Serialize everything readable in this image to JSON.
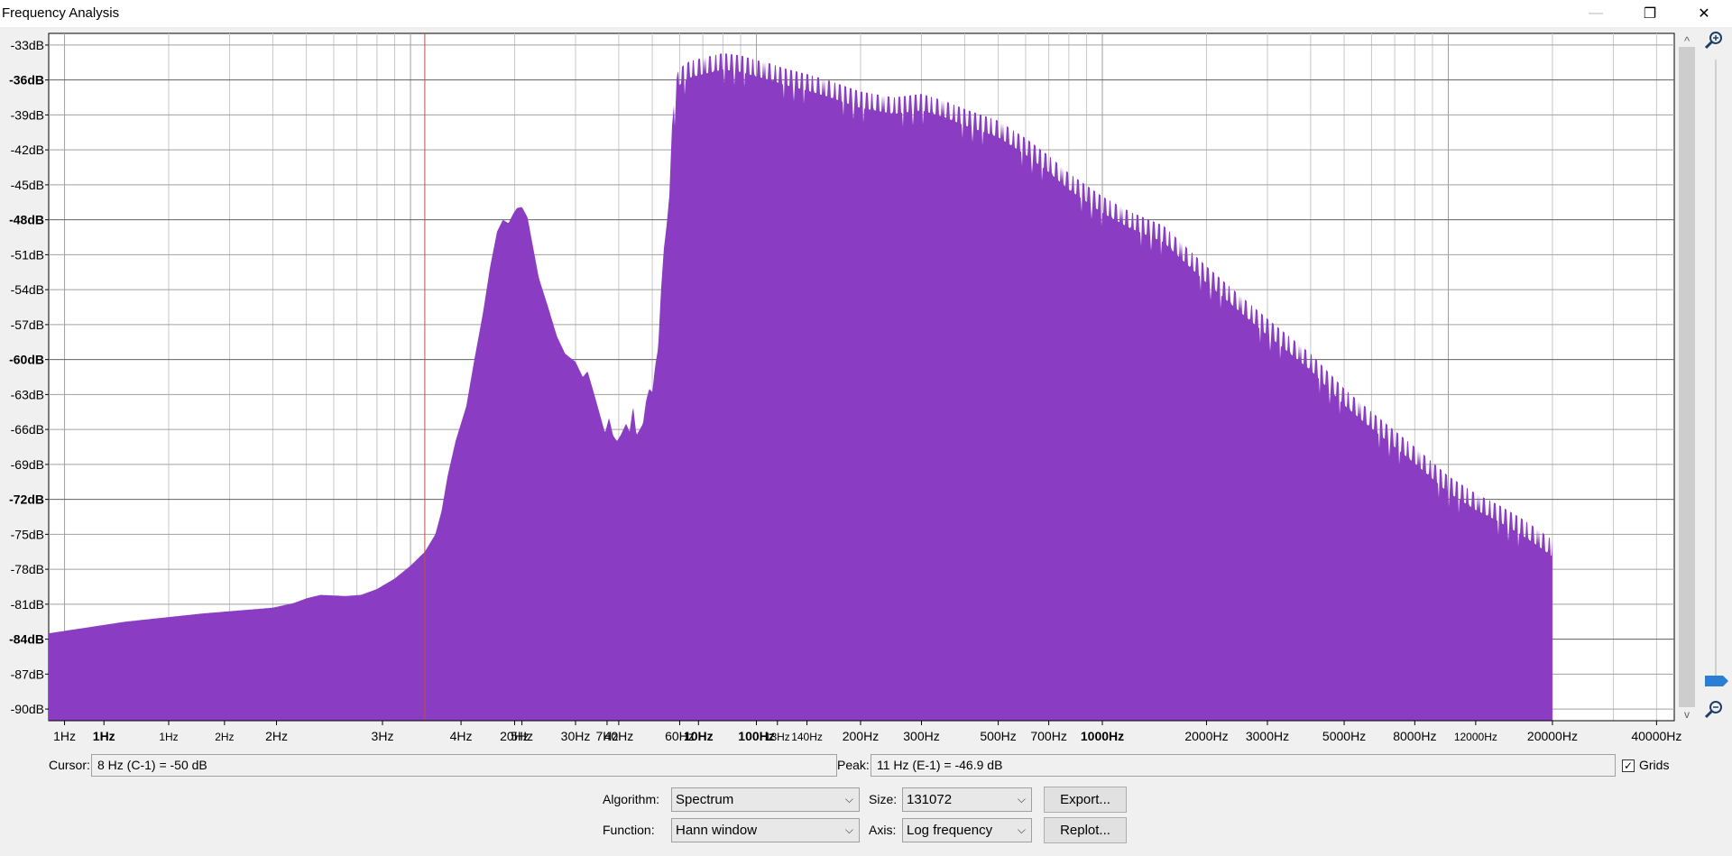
{
  "window": {
    "title": "Frequency Analysis",
    "controls": {
      "minimize": "—",
      "restore": "❐",
      "close": "✕"
    }
  },
  "colors": {
    "spectrum_fill": "#8a3cc2",
    "grid_major": "#a0a0a0",
    "grid_minor": "#c8c8c8",
    "cursor_line": "#c0504d"
  },
  "chart_data": {
    "type": "area",
    "xscale": "log",
    "x_unit": "Hz",
    "y_unit": "dB",
    "xlim": [
      0.9,
      45000
    ],
    "ylim": [
      -91,
      -32
    ],
    "grid": true,
    "y_ticks": [
      {
        "value": -33,
        "label": "-33dB",
        "bold": false
      },
      {
        "value": -36,
        "label": "-36dB",
        "bold": true
      },
      {
        "value": -39,
        "label": "-39dB",
        "bold": false
      },
      {
        "value": -42,
        "label": "-42dB",
        "bold": false
      },
      {
        "value": -45,
        "label": "-45dB",
        "bold": false
      },
      {
        "value": -48,
        "label": "-48dB",
        "bold": true
      },
      {
        "value": -51,
        "label": "-51dB",
        "bold": false
      },
      {
        "value": -54,
        "label": "-54dB",
        "bold": false
      },
      {
        "value": -57,
        "label": "-57dB",
        "bold": false
      },
      {
        "value": -60,
        "label": "-60dB",
        "bold": true
      },
      {
        "value": -63,
        "label": "-63dB",
        "bold": false
      },
      {
        "value": -66,
        "label": "-66dB",
        "bold": false
      },
      {
        "value": -69,
        "label": "-69dB",
        "bold": false
      },
      {
        "value": -72,
        "label": "-72dB",
        "bold": true
      },
      {
        "value": -75,
        "label": "-75dB",
        "bold": false
      },
      {
        "value": -78,
        "label": "-78dB",
        "bold": false
      },
      {
        "value": -81,
        "label": "-81dB",
        "bold": false
      },
      {
        "value": -84,
        "label": "-84dB",
        "bold": true
      },
      {
        "value": -87,
        "label": "-87dB",
        "bold": false
      },
      {
        "value": -90,
        "label": "-90dB",
        "bold": false
      }
    ],
    "x_ticks": [
      {
        "value": 1,
        "label": "1Hz",
        "bold": false,
        "small": false
      },
      {
        "value": 1.3,
        "label": "1Hz",
        "bold": true,
        "small": false
      },
      {
        "value": 2,
        "label": "1Hz",
        "bold": false,
        "small": true
      },
      {
        "value": 2.9,
        "label": "2Hz",
        "bold": false,
        "small": true
      },
      {
        "value": 4.1,
        "label": "2Hz",
        "bold": false,
        "small": false
      },
      {
        "value": 8.3,
        "label": "3Hz",
        "bold": false,
        "small": false
      },
      {
        "value": 14,
        "label": "4Hz",
        "bold": false,
        "small": false
      },
      {
        "value": 21,
        "label": "5Hz",
        "bold": false,
        "small": false
      },
      {
        "value": 37,
        "label": "7Hz",
        "bold": false,
        "small": false
      },
      {
        "value": 68,
        "label": "10Hz",
        "bold": true,
        "small": false
      },
      {
        "value": 115,
        "label": "13Hz",
        "bold": false,
        "small": true
      },
      {
        "value": 20,
        "label": "20Hz",
        "bold": false,
        "small": false
      },
      {
        "value": 30,
        "label": "30Hz",
        "bold": false,
        "small": false
      },
      {
        "value": 40,
        "label": "40Hz",
        "bold": false,
        "small": false
      },
      {
        "value": 60,
        "label": "60Hz",
        "bold": false,
        "small": false
      },
      {
        "value": 100,
        "label": "100Hz",
        "bold": true,
        "small": false
      },
      {
        "value": 140,
        "label": "140Hz",
        "bold": false,
        "small": true
      },
      {
        "value": 200,
        "label": "200Hz",
        "bold": false,
        "small": false
      },
      {
        "value": 300,
        "label": "300Hz",
        "bold": false,
        "small": false
      },
      {
        "value": 500,
        "label": "500Hz",
        "bold": false,
        "small": false
      },
      {
        "value": 700,
        "label": "700Hz",
        "bold": false,
        "small": false
      },
      {
        "value": 1000,
        "label": "1000Hz",
        "bold": true,
        "small": false
      },
      {
        "value": 2000,
        "label": "2000Hz",
        "bold": false,
        "small": false
      },
      {
        "value": 3000,
        "label": "3000Hz",
        "bold": false,
        "small": false
      },
      {
        "value": 5000,
        "label": "5000Hz",
        "bold": false,
        "small": false
      },
      {
        "value": 8000,
        "label": "8000Hz",
        "bold": false,
        "small": false
      },
      {
        "value": 12000,
        "label": "12000Hz",
        "bold": false,
        "small": true
      },
      {
        "value": 20000,
        "label": "20000Hz",
        "bold": false,
        "small": false
      },
      {
        "value": 40000,
        "label": "40000Hz",
        "bold": false,
        "small": false
      }
    ],
    "cursor_freq": 11,
    "spectrum": [
      [
        0.9,
        -83.5
      ],
      [
        1.5,
        -82.5
      ],
      [
        2.5,
        -81.8
      ],
      [
        4,
        -81.3
      ],
      [
        4.6,
        -80.9
      ],
      [
        5,
        -80.5
      ],
      [
        5.5,
        -80.2
      ],
      [
        6.5,
        -80.3
      ],
      [
        7.2,
        -80.2
      ],
      [
        8,
        -79.7
      ],
      [
        9,
        -78.8
      ],
      [
        10,
        -77.7
      ],
      [
        11,
        -76.5
      ],
      [
        11.8,
        -75
      ],
      [
        12.3,
        -73
      ],
      [
        12.8,
        -70
      ],
      [
        13.5,
        -67
      ],
      [
        14.5,
        -64
      ],
      [
        15.3,
        -60
      ],
      [
        16.2,
        -56
      ],
      [
        17,
        -52
      ],
      [
        17.8,
        -49
      ],
      [
        18.5,
        -48
      ],
      [
        19.2,
        -48.3
      ],
      [
        19.8,
        -47.5
      ],
      [
        20.3,
        -47
      ],
      [
        21,
        -46.9
      ],
      [
        21.8,
        -47.8
      ],
      [
        22.5,
        -50
      ],
      [
        23.5,
        -53
      ],
      [
        25,
        -55.5
      ],
      [
        26.5,
        -58
      ],
      [
        28,
        -59.5
      ],
      [
        30,
        -60.2
      ],
      [
        31.5,
        -61.5
      ],
      [
        32.5,
        -61
      ],
      [
        34,
        -63
      ],
      [
        35.5,
        -65
      ],
      [
        36.5,
        -66.3
      ],
      [
        37.5,
        -65
      ],
      [
        38.5,
        -66.5
      ],
      [
        39.5,
        -67
      ],
      [
        40.5,
        -66.5
      ],
      [
        42,
        -65.5
      ],
      [
        43,
        -66.2
      ],
      [
        44,
        -64
      ],
      [
        45,
        -66.5
      ],
      [
        46,
        -66
      ],
      [
        47,
        -65.5
      ],
      [
        48,
        -63.5
      ],
      [
        49,
        -62.5
      ],
      [
        50,
        -62.8
      ],
      [
        51,
        -60.5
      ],
      [
        52,
        -59
      ],
      [
        53,
        -54
      ],
      [
        54,
        -50.5
      ],
      [
        55,
        -48.5
      ],
      [
        56,
        -46
      ],
      [
        57,
        -40
      ],
      [
        58,
        -37.5
      ],
      [
        59,
        -35.5
      ],
      [
        60,
        -35
      ],
      [
        64,
        -34.4
      ],
      [
        70,
        -34.1
      ],
      [
        80,
        -33.7
      ],
      [
        90,
        -33.9
      ],
      [
        100,
        -34.3
      ],
      [
        110,
        -34.6
      ],
      [
        120,
        -35
      ],
      [
        140,
        -35.5
      ],
      [
        160,
        -36
      ],
      [
        200,
        -37
      ],
      [
        250,
        -37.5
      ],
      [
        300,
        -37.2
      ],
      [
        350,
        -37.8
      ],
      [
        400,
        -38.5
      ],
      [
        500,
        -39.5
      ],
      [
        600,
        -41
      ],
      [
        700,
        -42.5
      ],
      [
        800,
        -44
      ],
      [
        1000,
        -46
      ],
      [
        1200,
        -47.3
      ],
      [
        1500,
        -48.5
      ],
      [
        2000,
        -52
      ],
      [
        2500,
        -54.5
      ],
      [
        3000,
        -56.5
      ],
      [
        4000,
        -59.5
      ],
      [
        5000,
        -62.5
      ],
      [
        6000,
        -64.5
      ],
      [
        8000,
        -67.5
      ],
      [
        10000,
        -70
      ],
      [
        12000,
        -71.5
      ],
      [
        14000,
        -72.5
      ],
      [
        16000,
        -73.5
      ],
      [
        18000,
        -74.5
      ],
      [
        20000,
        -75.5
      ],
      [
        20100,
        -91
      ]
    ]
  },
  "cursor": {
    "label": "Cursor:",
    "value": "8 Hz (C-1) = -50 dB"
  },
  "peak": {
    "label": "Peak:",
    "value": "11 Hz (E-1) = -46.9 dB"
  },
  "grids": {
    "label": "Grids",
    "checked": true,
    "check_mark": "✓"
  },
  "algorithm": {
    "label": "Algorithm:",
    "value": "Spectrum"
  },
  "function": {
    "label": "Function:",
    "value": "Hann window"
  },
  "size": {
    "label": "Size:",
    "value": "131072"
  },
  "axis": {
    "label": "Axis:",
    "value": "Log frequency"
  },
  "buttons": {
    "export": "Export...",
    "replot": "Replot..."
  },
  "chevron": "⌵",
  "scroll": {
    "up": "^",
    "down": "v"
  }
}
